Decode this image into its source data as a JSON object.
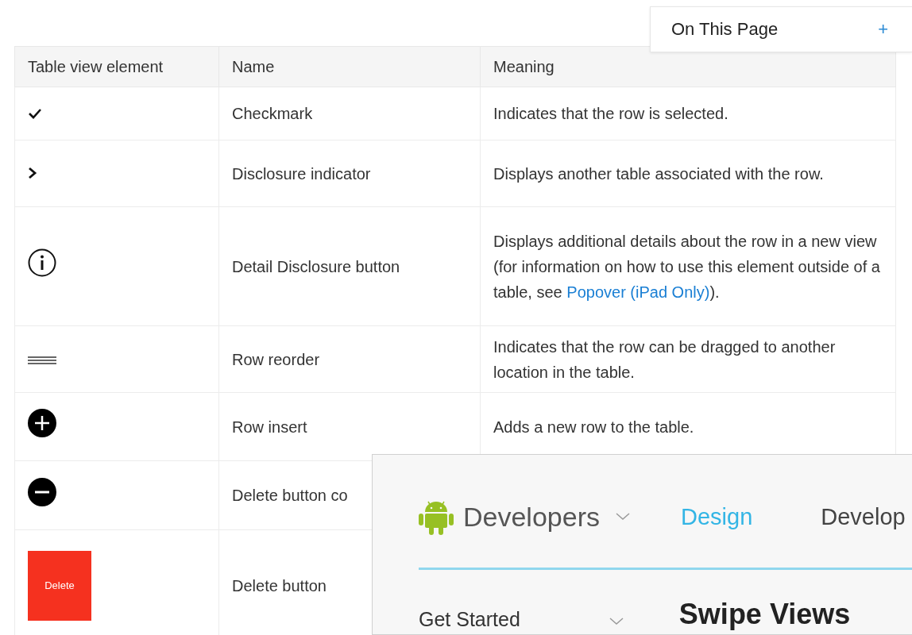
{
  "on_this_page": {
    "label": "On This Page",
    "toggle": "+"
  },
  "table": {
    "columns": [
      "Table view element",
      "Name",
      "Meaning"
    ],
    "rows": [
      {
        "kind": "checkmark",
        "name": "Checkmark",
        "meaning": {
          "text": "Indicates that the row is selected."
        }
      },
      {
        "kind": "chevron",
        "name": "Disclosure indicator",
        "meaning": {
          "text": "Displays another table associated with the row."
        }
      },
      {
        "kind": "info",
        "name": "Detail Disclosure button",
        "meaning": {
          "text": "Displays additional details about the row in a new view (for information on how to use this element outside of a table, see ",
          "link": "Popover (iPad Only)",
          "after": ")."
        }
      },
      {
        "kind": "reorder",
        "name": "Row reorder",
        "meaning": {
          "text": "Indicates that the row can be dragged to another location in the table."
        }
      },
      {
        "kind": "insert",
        "name": "Row insert",
        "meaning": {
          "text": "Adds a new row to the table."
        }
      },
      {
        "kind": "remove",
        "name": "Delete button co"
      },
      {
        "kind": "delete",
        "label": "Delete",
        "name": "Delete button"
      }
    ]
  },
  "overlay_window": {
    "brand": "Developers",
    "nav": [
      {
        "label": "Design",
        "selected": true
      },
      {
        "label": "Develop",
        "selected": false
      }
    ],
    "sidebar_item": "Get Started",
    "heading": "Swipe Views"
  }
}
